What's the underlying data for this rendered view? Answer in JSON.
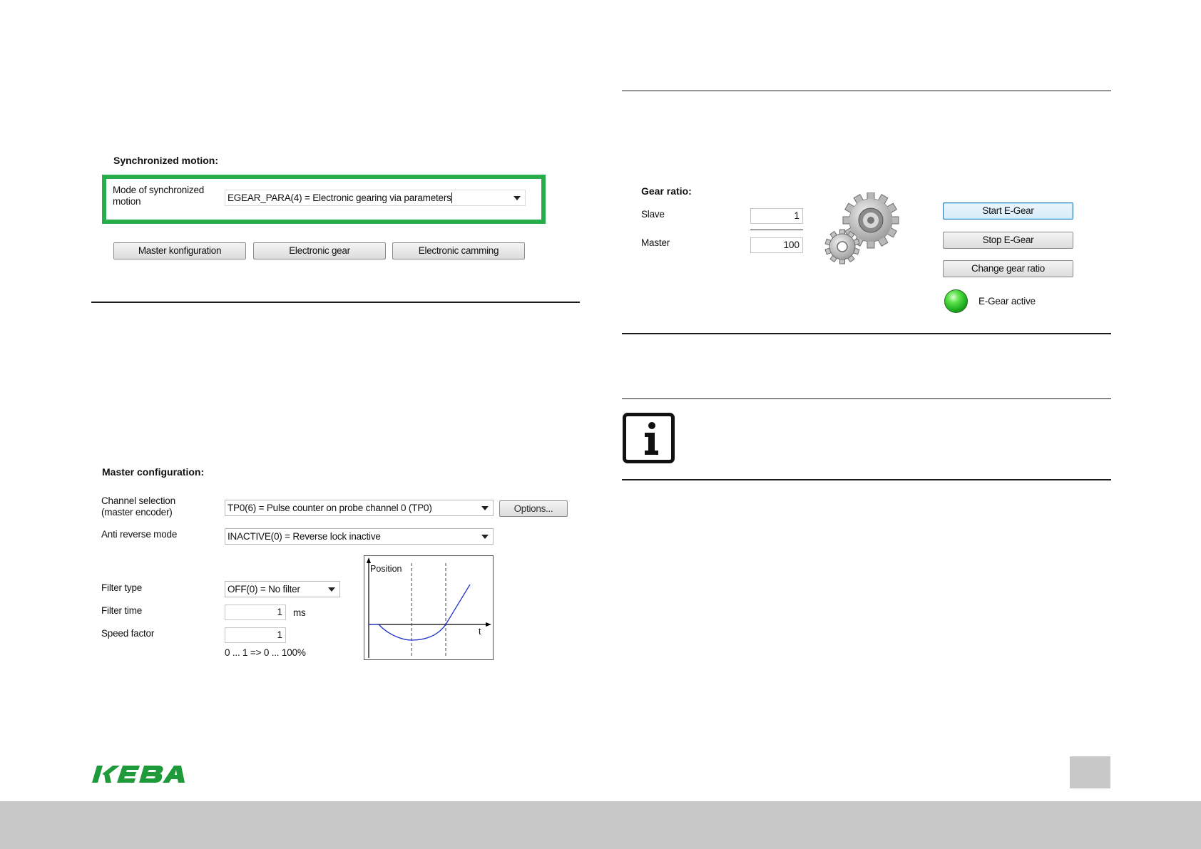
{
  "sync": {
    "title": "Synchronized motion:",
    "mode_label_line1": "Mode of synchronized",
    "mode_label_line2": "motion",
    "mode_value": "EGEAR_PARA(4) = Electronic gearing via parameters",
    "buttons": [
      "Master konfiguration",
      "Electronic gear",
      "Electronic camming"
    ]
  },
  "master": {
    "title": "Master configuration:",
    "channel_label_line1": "Channel selection",
    "channel_label_line2": "(master encoder)",
    "channel_value": "TP0(6) = Pulse counter on probe channel 0 (TP0)",
    "options_button": "Options...",
    "anti_reverse_label": "Anti reverse mode",
    "anti_reverse_value": "INACTIVE(0) = Reverse lock inactive",
    "filter_type_label": "Filter type",
    "filter_type_value": "OFF(0) = No filter",
    "filter_time_label": "Filter time",
    "filter_time_value": "1",
    "filter_time_unit": "ms",
    "speed_factor_label": "Speed factor",
    "speed_factor_value": "1",
    "speed_factor_range": "0 ... 1 => 0 ... 100%",
    "plot_y_label": "Position",
    "plot_x_label": "t"
  },
  "gear": {
    "title": "Gear ratio:",
    "slave_label": "Slave",
    "slave_value": "1",
    "master_label": "Master",
    "master_value": "100",
    "start_button": "Start E-Gear",
    "stop_button": "Stop E-Gear",
    "change_button": "Change gear ratio",
    "status_label": "E-Gear active",
    "status_color": "#22b322"
  },
  "icons": [
    "gears-icon",
    "info-icon",
    "led-indicator",
    "keba-logo"
  ],
  "brand": {
    "logo_text": "KEBA",
    "logo_color": "#1f9a3a"
  }
}
